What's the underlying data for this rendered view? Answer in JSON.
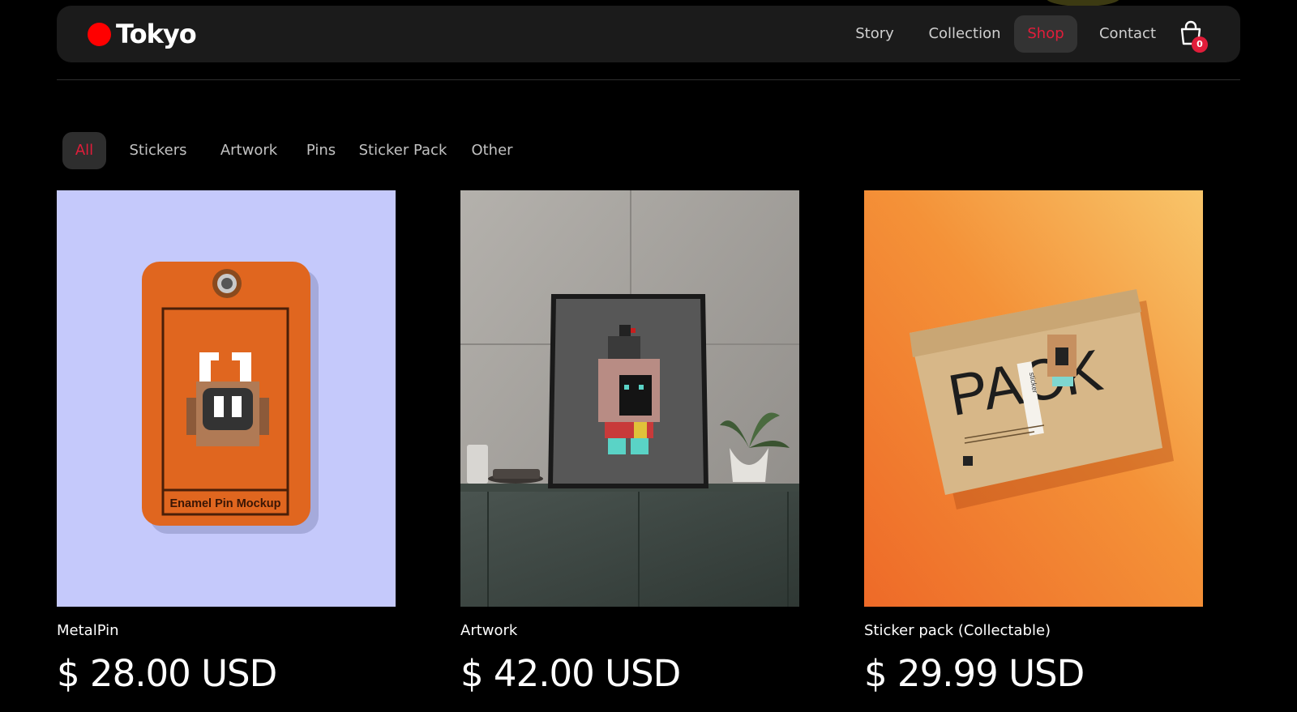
{
  "brand": {
    "name": "Tokyo",
    "accent": "#e11d3a",
    "dot_color": "#ff0000"
  },
  "nav": {
    "items": [
      {
        "label": "Story",
        "active": false
      },
      {
        "label": "Collection",
        "active": false
      },
      {
        "label": "Shop",
        "active": true
      },
      {
        "label": "Contact",
        "active": false
      }
    ],
    "cart": {
      "icon": "shopping-bag-icon",
      "count": "0"
    }
  },
  "filters": {
    "items": [
      {
        "label": "All",
        "active": true
      },
      {
        "label": "Stickers",
        "active": false
      },
      {
        "label": "Artwork",
        "active": false
      },
      {
        "label": "Pins",
        "active": false
      },
      {
        "label": "Sticker Pack",
        "active": false
      },
      {
        "label": "Other",
        "active": false
      }
    ]
  },
  "products": [
    {
      "title": "MetalPin",
      "price": "$ 28.00 USD",
      "image_text": "Enamel Pin Mockup",
      "bg": "#c5c9fb"
    },
    {
      "title": "Artwork",
      "price": "$ 42.00 USD",
      "bg": "#9e9c98"
    },
    {
      "title": "Sticker pack (Collectable)",
      "price": "$ 29.99 USD",
      "image_text": "PACK",
      "image_small_text": "sticker",
      "bg": "#f28a32"
    }
  ]
}
